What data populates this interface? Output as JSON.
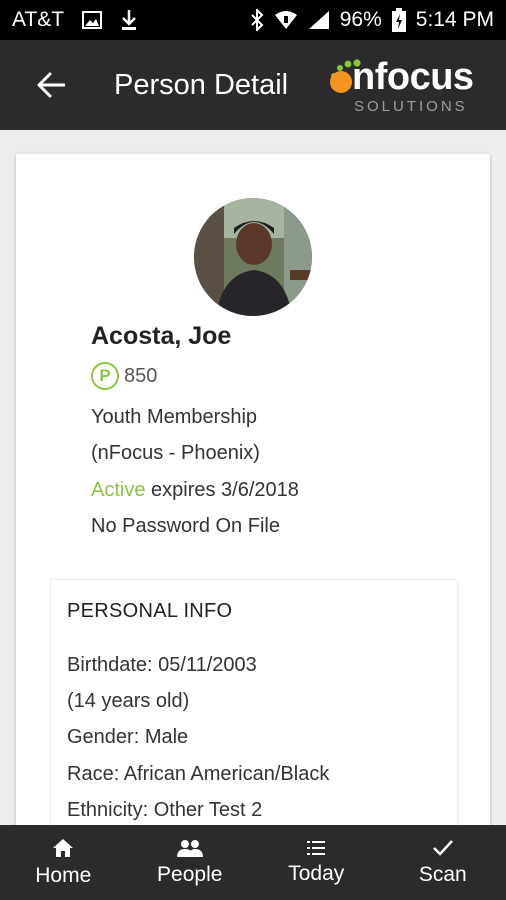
{
  "status_bar": {
    "carrier": "AT&T",
    "battery": "96%",
    "time": "5:14 PM"
  },
  "app_bar": {
    "title": "Person Detail",
    "logo_word": "nfocus",
    "logo_sub": "SOLUTIONS",
    "logo_colors": {
      "orange": "#f7941d",
      "green": "#8cc63f"
    }
  },
  "person": {
    "name": "Acosta, Joe",
    "points_badge": "P",
    "points": "850",
    "membership": "Youth Membership",
    "location": "(nFocus - Phoenix)",
    "status": "Active",
    "expires": " expires 3/6/2018",
    "password": "No Password On File"
  },
  "personal_info": {
    "title": "PERSONAL INFO",
    "birthdate": "Birthdate: 05/11/2003",
    "age": "(14 years old)",
    "gender": "Gender: Male",
    "race": "Race: African American/Black",
    "ethnicity": "Ethnicity: Other Test 2"
  },
  "bottom_nav": {
    "home": "Home",
    "people": "People",
    "today": "Today",
    "scan": "Scan"
  },
  "colors": {
    "accent_green": "#8cc63f",
    "bar_dark": "#2b2b2b"
  }
}
